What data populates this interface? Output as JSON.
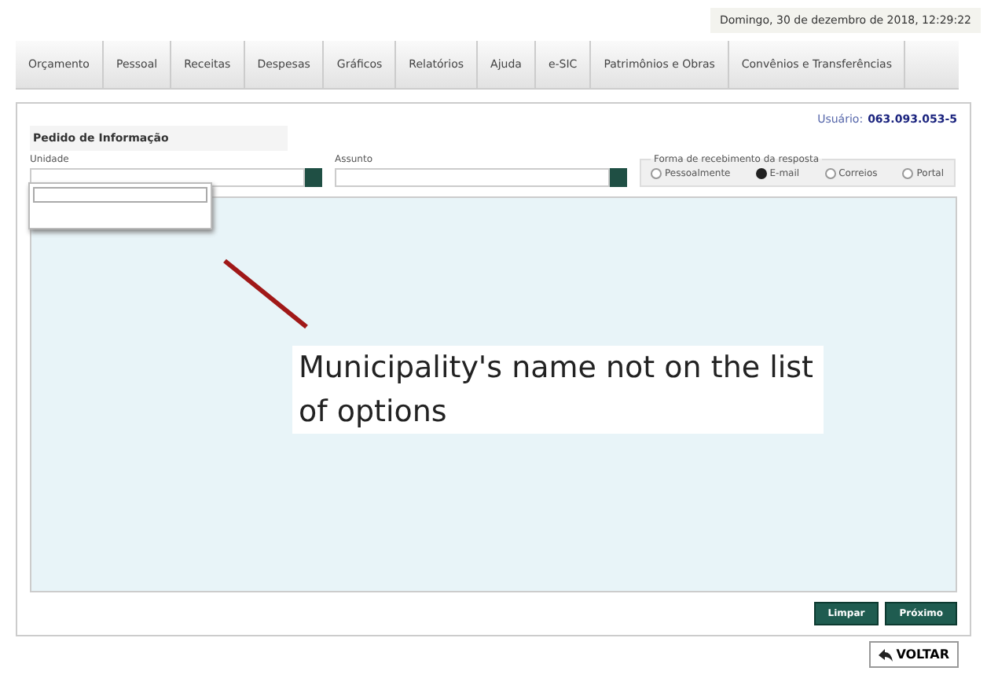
{
  "header": {
    "datetime": "Domingo, 30 de dezembro de 2018, 12:29:22"
  },
  "tabs": [
    {
      "label": "Orçamento",
      "selected": false
    },
    {
      "label": "Pessoal",
      "selected": false
    },
    {
      "label": "Receitas",
      "selected": false
    },
    {
      "label": "Despesas",
      "selected": false
    },
    {
      "label": "Gráficos",
      "selected": false
    },
    {
      "label": "Relatórios",
      "selected": false
    },
    {
      "label": "Ajuda",
      "selected": false
    },
    {
      "label": "e-SIC",
      "selected": false
    },
    {
      "label": "Patrimônios e Obras",
      "selected": false
    },
    {
      "label": "Convênios e Transferências",
      "selected": false
    }
  ],
  "user": {
    "label": "Usuário:",
    "id": "063.093.053-5"
  },
  "form": {
    "title": "Pedido de Informação",
    "fields": [
      {
        "label": "Unidade"
      },
      {
        "label": "Assunto"
      }
    ],
    "response": {
      "legend": "Forma de recebimento da resposta",
      "options": [
        {
          "label": "Pessoalmente",
          "selected": false
        },
        {
          "label": "E-mail",
          "selected": true
        },
        {
          "label": "Correios",
          "selected": false
        },
        {
          "label": "Portal",
          "selected": false
        }
      ]
    },
    "buttons": [
      {
        "label": "Limpar"
      },
      {
        "label": "Próximo"
      }
    ]
  },
  "annotation": {
    "text": "Municipality's name not on the list of options"
  },
  "back_button": {
    "label": "VOLTAR"
  }
}
